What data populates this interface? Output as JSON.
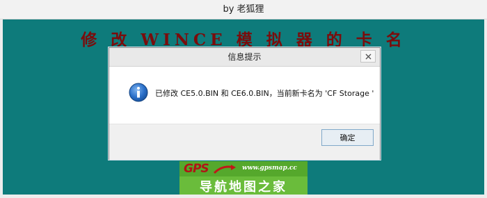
{
  "window": {
    "title": "by 老狐狸"
  },
  "client": {
    "heading": "修 改 WINCE 模 拟 器 的 卡 名"
  },
  "dialog": {
    "title": "信息提示",
    "message": "已修改 CE5.0.BIN 和 CE6.0.BIN，当前新卡名为 'CF Storage '",
    "ok_label": "确定",
    "icon": "info-icon",
    "close_icon": "close-icon"
  },
  "logo": {
    "brand": "GPS",
    "url": "www.gpsmap.cc",
    "name": "导航地图之家"
  },
  "colors": {
    "client_background": "#0e7b7b",
    "heading": "#7a0c0c",
    "info_icon": "#1a5fb4",
    "logo_green": "#6abc3b"
  }
}
